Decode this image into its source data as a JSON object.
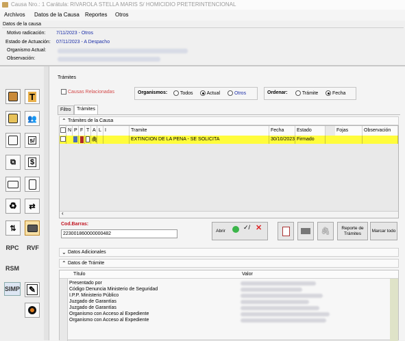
{
  "window": {
    "title": "Causa Nro.: 1 Carátula: RIVAROLA STELLA MARIS S/ HOMICIDIO PRETERINTENCIONAL"
  },
  "menu": [
    "Archivos",
    "Datos de la Causa",
    "Reportes",
    "Otros"
  ],
  "causa": {
    "legend": "Datos de la causa",
    "motivo_label": "Motivo radicación:",
    "motivo_value": "7/11/2023 - Otros",
    "estado_label": "Estado de Actuación:",
    "estado_value": "07/11/2023 - A Despacho",
    "organismo_label": "Organismo Actual:",
    "observacion_label": "Observación:"
  },
  "toolbar_left": {
    "text_buttons": [
      "RPC",
      "RVF",
      "RSM",
      "SIMP"
    ]
  },
  "tramites": {
    "title": "Trámites",
    "causas_relacionadas": "Causas Relacionadas",
    "organismos_label": "Organismos:",
    "organismos_options": [
      "Todos",
      "Actual",
      "Otros"
    ],
    "organismos_selected": "Actual",
    "ordenar_label": "Ordenar:",
    "ordenar_options": [
      "Trámite",
      "Fecha"
    ],
    "ordenar_selected": "Fecha",
    "tabs": [
      "Filtro",
      "Trámites"
    ],
    "active_tab": "Trámites",
    "section_title": "Trámites de la Causa",
    "columns": [
      "N",
      "P",
      "F",
      "T",
      "A",
      "L",
      "I",
      "Tramite",
      "Fecha",
      "Estado",
      "Fojas",
      "Observación"
    ],
    "rows": [
      {
        "tramite": "EXTINCION DE LA PENA - SE SOLICITA",
        "fecha": "30/10/2023",
        "estado": "Firmado",
        "fojas": "",
        "observacion": ""
      }
    ]
  },
  "barcode": {
    "label": "Cod.Barras:",
    "value": "223001860000000482"
  },
  "actions": {
    "abrir": "Abrir",
    "reporte": "Reporte de Trámites",
    "marcar": "Marcar todo"
  },
  "sections": {
    "datos_adicionales": "Datos Adicionales",
    "datos_tramite": "Datos de Trámite"
  },
  "datos_tramite": {
    "columns": [
      "Título",
      "Valor"
    ],
    "rows": [
      "Presentado por",
      "Código Denuncia Ministerio de Seguridad",
      "I.P.P. Ministerio Público",
      "Juzgado de Garantías",
      "Juzgado de Garantías",
      "Organismo con Acceso al Expediente",
      "Organismo con Acceso al Expediente"
    ]
  },
  "colors": {
    "selected_row": "#fffc3b",
    "link_blue": "#1b2ea8",
    "barcode_red": "#c1121f",
    "causas_rel_red": "#d44a4a"
  }
}
